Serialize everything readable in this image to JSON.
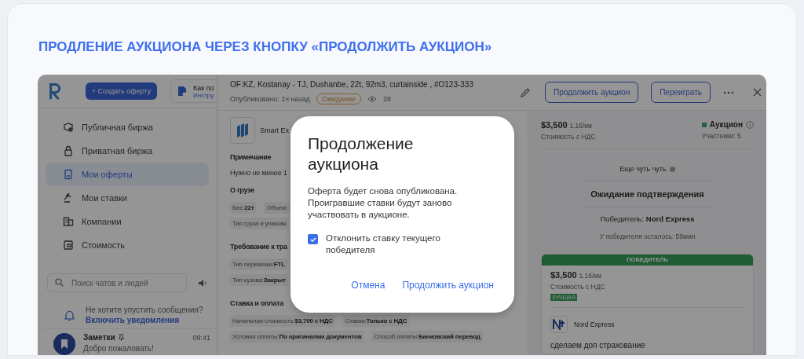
{
  "heading": "ПРОДЛЕНИЕ АУКЦИОНА ЧЕРЕЗ КНОПКУ «ПРОДОЛЖИТЬ АУКЦИОН»",
  "sidebar": {
    "create_button": "+ Создать оферту",
    "help": {
      "title": "Как по",
      "link": "Инстру"
    },
    "nav": [
      {
        "label": "Публичная биржа",
        "selected": false
      },
      {
        "label": "Приватная биржа",
        "selected": false
      },
      {
        "label": "Мои оферты",
        "selected": true
      },
      {
        "label": "Мои ставки",
        "selected": false
      },
      {
        "label": "Компании",
        "selected": false
      },
      {
        "label": "Стоимость",
        "selected": false
      }
    ],
    "search": {
      "placeholder": "Поиск чатов и людей"
    },
    "notice": {
      "text": "Не хотите упустить сообщения?",
      "link": "Включить уведомления"
    },
    "chat": {
      "name": "Заметки",
      "pinned": true,
      "message": "Добро пожаловать!",
      "time": "09:41"
    }
  },
  "offer": {
    "title": "OF:KZ, Kostanay - TJ, Dushanbe, 22t, 92m3, curtainside , #O123-333",
    "published": "Опубликовано: 1ч назад",
    "status": "Ожидание",
    "views": "28",
    "actions": [
      "Продолжить аукцион",
      "Переиграть"
    ],
    "company": "Smart Ex",
    "sections": [
      {
        "title": "Примечание",
        "kind": "note",
        "text": "Нужно не менее 1"
      },
      {
        "title": "О грузе",
        "kind": "fields",
        "rows": [
          [
            {
              "label": "Вес:",
              "value": "22т"
            },
            {
              "label": "Объем:"
            }
          ],
          [
            {
              "label": "Тип груза и упаковк"
            }
          ]
        ]
      },
      {
        "title": "Требование к тра",
        "kind": "fields",
        "rows": [
          [
            {
              "label": "Тип перевозки:",
              "value": "FTL"
            }
          ],
          [
            {
              "label": "Тип кузова:",
              "value": "Закрыт"
            }
          ]
        ]
      },
      {
        "title": "Ставка и оплата",
        "kind": "fields",
        "rows": [
          [
            {
              "label": "Начальная стоимость:",
              "value": "$3,700 с НДС"
            },
            {
              "label": "Ставки:",
              "value": "Только с НДС"
            }
          ],
          [
            {
              "label": "Условия оплаты:",
              "value": "По оригиналам документов"
            },
            {
              "label": "Способ оплаты:",
              "value": "Банковский перевод"
            }
          ]
        ]
      }
    ]
  },
  "auction": {
    "price": "$3,500",
    "per_km": "1.16/км",
    "price_note": "Стоимость с НДС",
    "mode": "Аукцион",
    "participants": "Участники: 5",
    "almost": "Еще чуть чуть",
    "waiting": "Ожидание подтверждения",
    "winner": "Победитель: **Nord Express**",
    "remaining": "У победителя осталось: 59мин",
    "winner_card": {
      "header": "ПОБЕДИТЕЛЬ",
      "price": "$3,500",
      "per_km": "1.16/км",
      "note": "Стоимость с НДС",
      "badge": "ЛУЧШАЯ",
      "company": "Nord Express",
      "comment": "сделаем доп страхование"
    }
  },
  "dialog": {
    "title": "Продолжение аукциона",
    "text": "Оферта будет снова опубликована. Проигравшие ставки будут заново участвовать в аукционе.",
    "checkbox": {
      "label": "Отклонить ставку текущего победителя",
      "checked": true
    },
    "buttons": [
      "Отмена",
      "Продолжить аукцион"
    ]
  }
}
